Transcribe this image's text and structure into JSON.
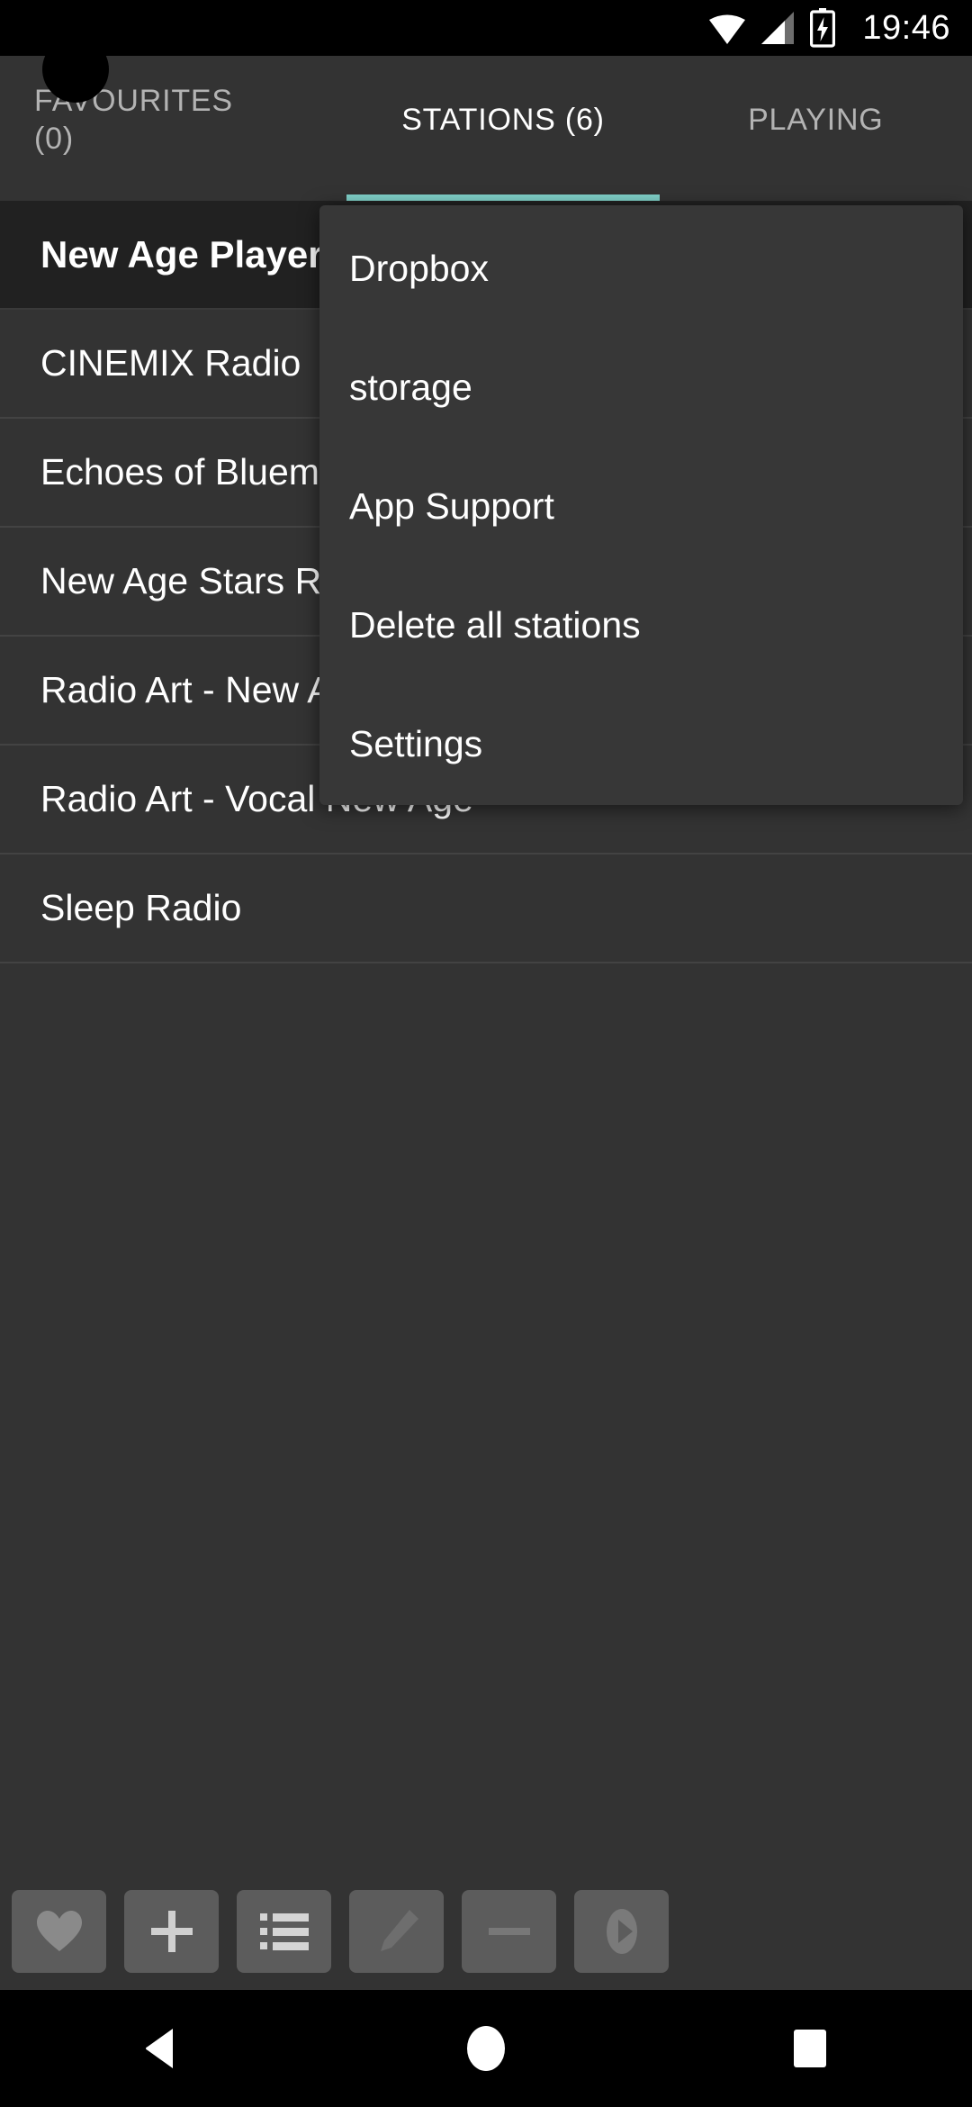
{
  "status_bar": {
    "time": "19:46",
    "icons": [
      "wifi-icon",
      "cellular-signal-icon",
      "battery-charging-icon"
    ]
  },
  "tabs": [
    {
      "label": "FAVOURITES\n(0)",
      "active": false,
      "name": "tab-favourites"
    },
    {
      "label": "STATIONS (6)",
      "active": true,
      "name": "tab-stations"
    },
    {
      "label": "PLAYING",
      "active": false,
      "name": "tab-playing"
    }
  ],
  "stations": [
    {
      "name": "New Age Player - Stations",
      "selected": true
    },
    {
      "name": "CINEMIX Radio",
      "selected": false
    },
    {
      "name": "Echoes of Bluemars - Music",
      "selected": false
    },
    {
      "name": "New Age Stars Radio",
      "selected": false
    },
    {
      "name": "Radio Art - New Age",
      "selected": false
    },
    {
      "name": "Radio Art - Vocal New Age",
      "selected": false
    },
    {
      "name": "Sleep Radio",
      "selected": false
    }
  ],
  "overflow_menu": {
    "items": [
      {
        "label": "Dropbox",
        "name": "menu-item-dropbox"
      },
      {
        "label": "storage",
        "name": "menu-item-storage"
      },
      {
        "label": "App Support",
        "name": "menu-item-app-support"
      },
      {
        "label": "Delete all stations",
        "name": "menu-item-delete-all-stations"
      },
      {
        "label": "Settings",
        "name": "menu-item-settings"
      }
    ]
  },
  "toolbar": {
    "buttons": [
      {
        "icon": "heart-icon",
        "name": "favourite-button"
      },
      {
        "icon": "plus-icon",
        "name": "add-station-button"
      },
      {
        "icon": "list-icon",
        "name": "list-button"
      },
      {
        "icon": "pencil-icon",
        "name": "edit-button"
      },
      {
        "icon": "minus-icon",
        "name": "remove-station-button"
      },
      {
        "icon": "play-icon",
        "name": "play-button"
      }
    ]
  },
  "nav_bar": {
    "buttons": [
      {
        "icon": "back-triangle-icon",
        "name": "nav-back-button"
      },
      {
        "icon": "home-circle-icon",
        "name": "nav-home-button"
      },
      {
        "icon": "recents-square-icon",
        "name": "nav-recents-button"
      }
    ]
  },
  "colors": {
    "accent": "#7fcfc7",
    "background": "#333333",
    "selected_row": "#212121",
    "menu_background": "#373737",
    "toolbar_button": "#5c5c5c"
  }
}
